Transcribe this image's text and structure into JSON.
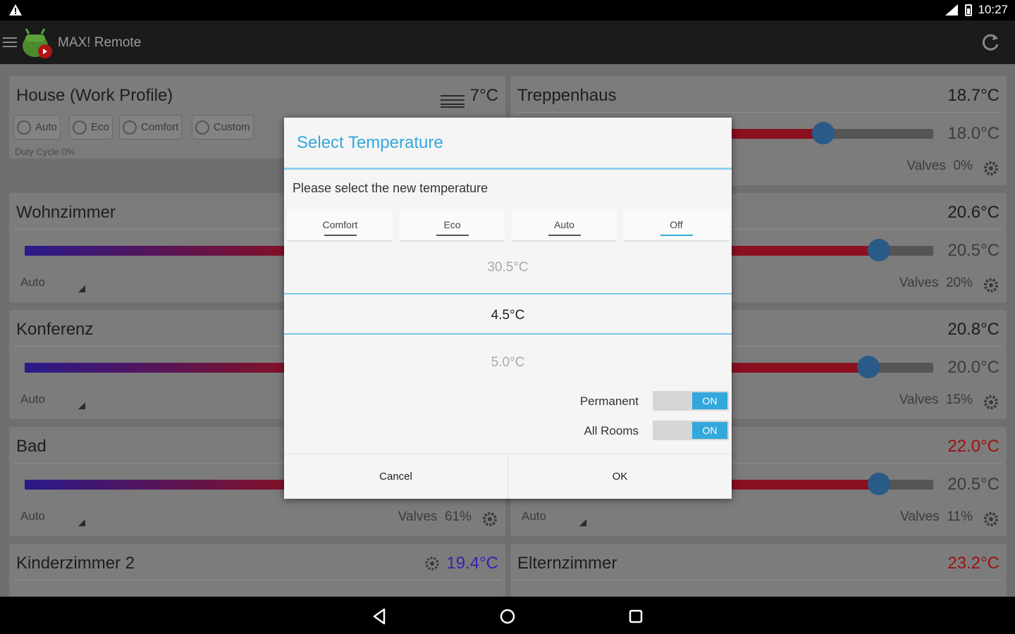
{
  "status_bar": {
    "time": "10:27"
  },
  "app": {
    "title": "MAX! Remote"
  },
  "house": {
    "name": "House (Work Profile)",
    "outside_temp": "7°C",
    "modes": [
      "Auto",
      "Eco",
      "Comfort",
      "Custom"
    ],
    "duty_cycle": "Duty Cycle 0%"
  },
  "rooms": [
    {
      "name": "Treppenhaus",
      "temp": "18.7°C",
      "set": "18.0°C",
      "valves_label": "Valves",
      "valves": "0%"
    },
    {
      "name": "Wohnzimmer",
      "mode": "Auto"
    },
    {
      "name": "",
      "temp": "20.6°C",
      "set": "20.5°C",
      "valves_label": "Valves",
      "valves": "20%"
    },
    {
      "name": "Konferenz",
      "mode": "Auto"
    },
    {
      "name": "",
      "temp": "20.8°C",
      "set": "20.0°C",
      "valves_label": "Valves",
      "valves": "15%"
    },
    {
      "name": "Bad",
      "mode": "Auto",
      "valves_label": "Valves",
      "valves": "61%"
    },
    {
      "name": "",
      "temp": "22.0°C",
      "set": "20.5°C",
      "mode": "Auto",
      "valves_label": "Valves",
      "valves": "11%"
    },
    {
      "name": "Kinderzimmer 2",
      "temp": "19.4°C"
    },
    {
      "name": "Elternzimmer",
      "temp": "23.2°C"
    }
  ],
  "dialog": {
    "title": "Select Temperature",
    "message": "Please select the new temperature",
    "tabs": [
      "Comfort",
      "Eco",
      "Auto",
      "Off"
    ],
    "active_tab": "Off",
    "picker": {
      "prev": "30.5°C",
      "current": "4.5°C",
      "next": "5.0°C"
    },
    "toggles": [
      {
        "label": "Permanent",
        "state": "ON"
      },
      {
        "label": "All Rooms",
        "state": "ON"
      }
    ],
    "buttons": {
      "cancel": "Cancel",
      "ok": "OK"
    }
  },
  "colors": {
    "accent": "#33a8dc",
    "hot": "#a01010",
    "cold": "#3a1fb0"
  }
}
